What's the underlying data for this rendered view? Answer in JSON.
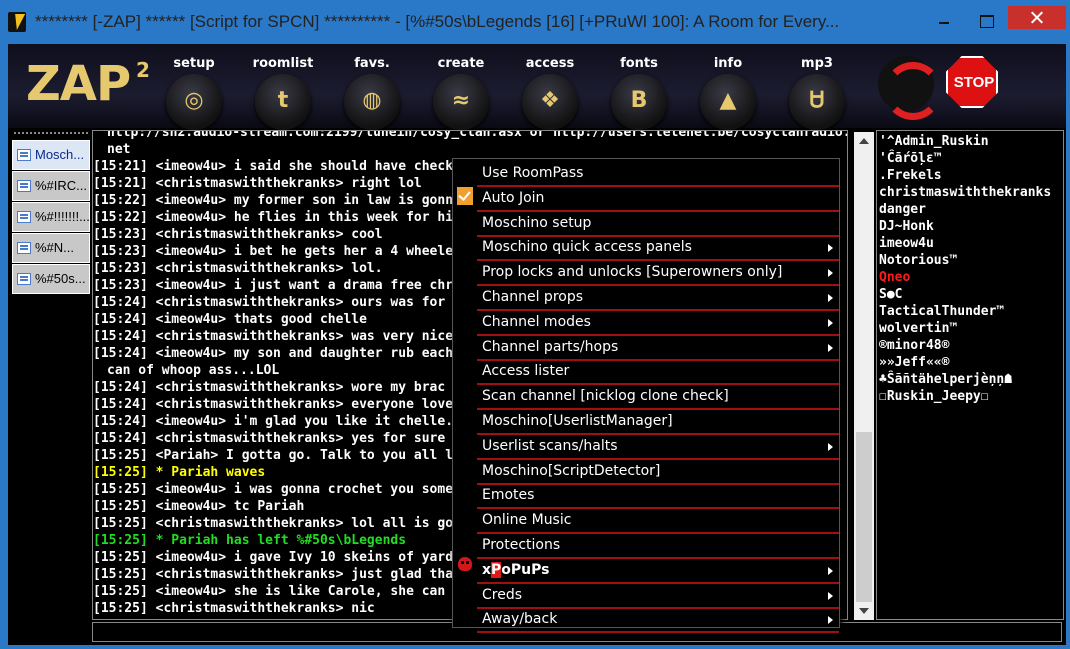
{
  "window": {
    "title": "******** [-ZAP] ****** [Script for SPCN] ********** - [%#50s\\bLegends [16] [+PRuWl 100]: A Room for Every..."
  },
  "colors": {
    "title_bg": "#2a78c8",
    "chat_bg": "#000000",
    "menu_separator": "#a01010",
    "logo": "#e6c86e",
    "close_button": "#c9302c"
  },
  "toolbar": {
    "logo": "ZAP",
    "logo_sup": "2",
    "buttons": [
      {
        "label": "setup",
        "icon": "instagram-icon",
        "glyph": "◎"
      },
      {
        "label": "roomlist",
        "icon": "tumblr-icon",
        "glyph": "t"
      },
      {
        "label": "favs.",
        "icon": "dribbble-icon",
        "glyph": "◍"
      },
      {
        "label": "create",
        "icon": "rss-icon",
        "glyph": "≈"
      },
      {
        "label": "access",
        "icon": "dropbox-icon",
        "glyph": "❖"
      },
      {
        "label": "fonts",
        "icon": "blogger-icon",
        "glyph": "B"
      },
      {
        "label": "info",
        "icon": "google-drive-icon",
        "glyph": "▲"
      },
      {
        "label": "mp3",
        "icon": "stumbleupon-icon",
        "glyph": "Ꮜ"
      }
    ],
    "refresh_icon": "refresh-icon",
    "stop_label": "STOP"
  },
  "sidebar": {
    "tabs": [
      "Mosch...",
      "%#IRC...",
      "%#!!!!!!!...",
      "%#N...",
      "%#50s..."
    ]
  },
  "chat": {
    "lines": [
      {
        "text": "http://sh2.audio-stream.com:2199/tunein/cosy_clan.asx or http://users.telenet.be/cosyclanradio.",
        "cls": "cont"
      },
      {
        "text": "net",
        "cls": "cont"
      },
      {
        "text": "[15:21] <imeow4u> i said she should have checked",
        "cls": ""
      },
      {
        "text": "[15:21] <christmaswiththekranks> right lol",
        "cls": ""
      },
      {
        "text": "[15:22] <imeow4u> my former son in law is gonna",
        "cls": ""
      },
      {
        "text": "[15:22] <imeow4u> he flies in this week for his 30",
        "cls": ""
      },
      {
        "text": "[15:23] <christmaswiththekranks> cool",
        "cls": ""
      },
      {
        "text": "[15:23] <imeow4u> i bet he gets her a 4 wheeler",
        "cls": ""
      },
      {
        "text": "[15:23] <christmaswiththekranks> lol.",
        "cls": ""
      },
      {
        "text": "[15:23] <imeow4u> i just want a drama free christ",
        "cls": ""
      },
      {
        "text": "[15:24] <christmaswiththekranks> ours was for a",
        "cls": ""
      },
      {
        "text": "[15:24] <imeow4u> thats good chelle",
        "cls": ""
      },
      {
        "text": "[15:24] <christmaswiththekranks> was very nice",
        "cls": ""
      },
      {
        "text": "[15:24] <imeow4u> my son and daughter rub each",
        "cls": ""
      },
      {
        "text": "can of whoop ass...LOL",
        "cls": "cont"
      },
      {
        "text": "[15:24] <christmaswiththekranks> wore my brac",
        "cls": ""
      },
      {
        "text": "[15:24] <christmaswiththekranks> everyone love",
        "cls": ""
      },
      {
        "text": "[15:24] <imeow4u> i'm glad you like it chelle....fr",
        "cls": ""
      },
      {
        "text": "[15:24] <christmaswiththekranks> yes for sure",
        "cls": ""
      },
      {
        "text": "[15:25] <Pariah> I gotta go. Talk to you all later.",
        "cls": ""
      },
      {
        "text": "[15:25] * Pariah waves",
        "cls": "yellow"
      },
      {
        "text": "[15:25] <imeow4u> i was gonna crochet you some",
        "cls": ""
      },
      {
        "text": "[15:25] <imeow4u> tc Pariah",
        "cls": ""
      },
      {
        "text": "[15:25] <christmaswiththekranks> lol all is good",
        "cls": ""
      },
      {
        "text": "[15:25] * Pariah has left %#50s\\bLegends",
        "cls": "green"
      },
      {
        "text": "[15:25] <imeow4u> i gave Ivy 10 skeins of yard S",
        "cls": ""
      },
      {
        "text": "[15:25] <christmaswiththekranks> just glad that",
        "cls": ""
      },
      {
        "text": "[15:25] <imeow4u> she is like Carole, she can ma",
        "cls": ""
      },
      {
        "text": "[15:25] <christmaswiththekranks> nic",
        "cls": ""
      }
    ]
  },
  "nicklist": [
    {
      "nick": "'^Admin_Ruskin",
      "cls": ""
    },
    {
      "nick": "'Ĉāŕōļε™",
      "cls": ""
    },
    {
      "nick": ".Frekels",
      "cls": ""
    },
    {
      "nick": "christmaswiththekranks",
      "cls": ""
    },
    {
      "nick": "danger",
      "cls": ""
    },
    {
      "nick": "DJ~Honk",
      "cls": ""
    },
    {
      "nick": "imeow4u",
      "cls": ""
    },
    {
      "nick": "Notorious™",
      "cls": ""
    },
    {
      "nick": "Qneo",
      "cls": "red"
    },
    {
      "nick": "S●C",
      "cls": ""
    },
    {
      "nick": "TacticalThunder™",
      "cls": ""
    },
    {
      "nick": "wolvertin™",
      "cls": ""
    },
    {
      "nick": "®minor48®",
      "cls": ""
    },
    {
      "nick": "»»Jeff««®",
      "cls": ""
    },
    {
      "nick": "♣Ŝãñtähelperjèņņ☗",
      "cls": ""
    },
    {
      "nick": "☐Ruskin_Jeepy☐",
      "cls": ""
    }
  ],
  "menu": {
    "items": [
      {
        "label": "Use RoomPass",
        "sub": false
      },
      {
        "label": "Auto Join",
        "sub": false,
        "checked": true
      },
      {
        "label": "Moschino setup",
        "sub": false
      },
      {
        "label": "Moschino quick access panels",
        "sub": true
      },
      {
        "label": "Prop locks and unlocks [Superowners only]",
        "sub": true
      },
      {
        "label": "Channel props",
        "sub": true
      },
      {
        "label": "Channel modes",
        "sub": true
      },
      {
        "label": "Channel parts/hops",
        "sub": true
      },
      {
        "label": "Access lister",
        "sub": false
      },
      {
        "label": "Scan channel [nicklog clone check]",
        "sub": false
      },
      {
        "label": "Moschino[UserlistManager]",
        "sub": false
      },
      {
        "label": "Userlist scans/halts",
        "sub": true
      },
      {
        "label": "Moschino[ScriptDetector]",
        "sub": false
      },
      {
        "label": "Emotes",
        "sub": false
      },
      {
        "label": "Online Music",
        "sub": false
      },
      {
        "label": "Protections",
        "sub": false
      },
      {
        "label": "xPoPuPs",
        "sub": true,
        "special": true
      },
      {
        "label": "Creds",
        "sub": true
      },
      {
        "label": "Away/back",
        "sub": true
      }
    ],
    "xpopups_parts": [
      "x",
      "P",
      "oPuPs"
    ],
    "skull_icon": "skull-icon"
  }
}
